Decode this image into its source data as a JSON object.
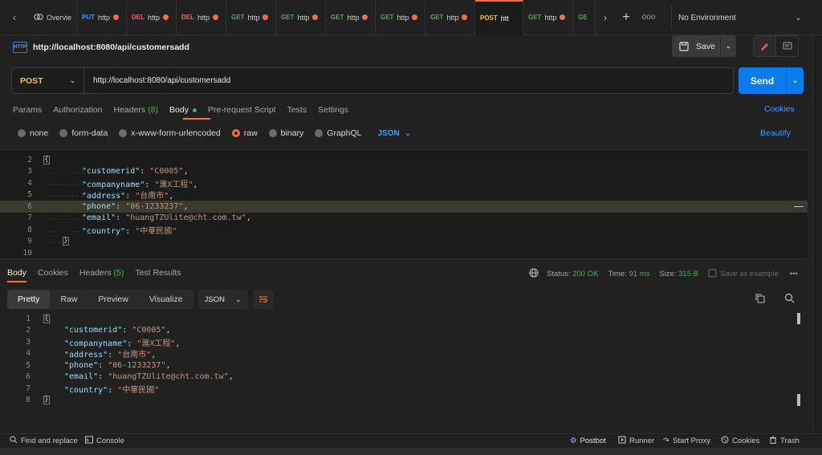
{
  "tabs": {
    "items": [
      {
        "method": "",
        "label": "Overvie",
        "method_color": "#cfcfcf",
        "dirty": false,
        "active": false
      },
      {
        "method": "PUT",
        "label": "http",
        "method_color": "#3e9bff",
        "dirty": true,
        "active": false
      },
      {
        "method": "DEL",
        "label": "http",
        "method_color": "#f26b6b",
        "dirty": true,
        "active": false
      },
      {
        "method": "DEL",
        "label": "http",
        "method_color": "#f26b6b",
        "dirty": true,
        "active": false
      },
      {
        "method": "GET",
        "label": "http",
        "method_color": "#4caf50",
        "dirty": true,
        "active": false
      },
      {
        "method": "GET",
        "label": "http",
        "method_color": "#4caf50",
        "dirty": true,
        "active": false
      },
      {
        "method": "GET",
        "label": "http",
        "method_color": "#4caf50",
        "dirty": true,
        "active": false
      },
      {
        "method": "GET",
        "label": "http",
        "method_color": "#4caf50",
        "dirty": true,
        "active": false
      },
      {
        "method": "GET",
        "label": "http",
        "method_color": "#4caf50",
        "dirty": true,
        "active": false
      },
      {
        "method": "POST",
        "label": "htt",
        "method_color": "#f4c430",
        "dirty": false,
        "active": true
      },
      {
        "method": "GET",
        "label": "http",
        "method_color": "#4caf50",
        "dirty": true,
        "active": false
      },
      {
        "method": "GE",
        "label": "",
        "method_color": "#4caf50",
        "dirty": false,
        "active": false
      }
    ],
    "more_label": "ooo",
    "environment": "No Environment"
  },
  "header": {
    "http_badge": "HTTP",
    "title": "http://localhost:8080/api/customersadd",
    "save_label": "Save"
  },
  "request": {
    "method": "POST",
    "url": "http://localhost:8080/api/customersadd",
    "send_label": "Send",
    "tabs": {
      "params": "Params",
      "authorization": "Authorization",
      "headers": "Headers",
      "headers_count": "(8)",
      "body": "Body",
      "prerequest": "Pre-request Script",
      "tests": "Tests",
      "settings": "Settings"
    },
    "cookies_label": "Cookies",
    "body_types": {
      "none": "none",
      "form_data": "form-data",
      "urlencoded": "x-www-form-urlencoded",
      "raw": "raw",
      "binary": "binary",
      "graphql": "GraphQL"
    },
    "format": "JSON",
    "beautify_label": "Beautify",
    "editor_lines": {
      "n2": "2",
      "n3": "3",
      "n4": "4",
      "n5": "5",
      "n6": "6",
      "n7": "7",
      "n8": "8",
      "n9": "9",
      "n10": "10",
      "k_customerid": "\"customerid\"",
      "v_customerid": "\"C0005\"",
      "k_companyname": "\"companyname\"",
      "v_companyname": "\"滙X工程\"",
      "k_address": "\"address\"",
      "v_address": "\"台南市\"",
      "k_phone": "\"phone\"",
      "v_phone": "\"06-1233237\"",
      "k_email": "\"email\"",
      "v_email": "\"huangTZUlite@cht.com.tw\"",
      "k_country": "\"country\"",
      "v_country": "\"中華民國\""
    }
  },
  "response": {
    "tabs": {
      "body": "Body",
      "cookies": "Cookies",
      "headers": "Headers",
      "headers_count": "(5)",
      "test_results": "Test Results"
    },
    "status_label": "Status:",
    "status_value": "200 OK",
    "time_label": "Time:",
    "time_value": "91 ms",
    "size_label": "Size:",
    "size_value": "315 B",
    "save_example": "Save as example",
    "views": {
      "pretty": "Pretty",
      "raw": "Raw",
      "preview": "Preview",
      "visualize": "Visualize"
    },
    "format": "JSON",
    "lines": {
      "n1": "1",
      "n2": "2",
      "n3": "3",
      "n4": "4",
      "n5": "5",
      "n6": "6",
      "n7": "7",
      "n8": "8"
    }
  },
  "statusbar": {
    "find_replace": "Find and replace",
    "console": "Console",
    "postbot": "Postbot",
    "runner": "Runner",
    "start_proxy": "Start Proxy",
    "cookies": "Cookies",
    "trash": "Trash"
  },
  "colors": {
    "accent": "#ff6c37",
    "primary": "#097bed",
    "success": "#4caf50",
    "method_post": "#f4c430"
  }
}
